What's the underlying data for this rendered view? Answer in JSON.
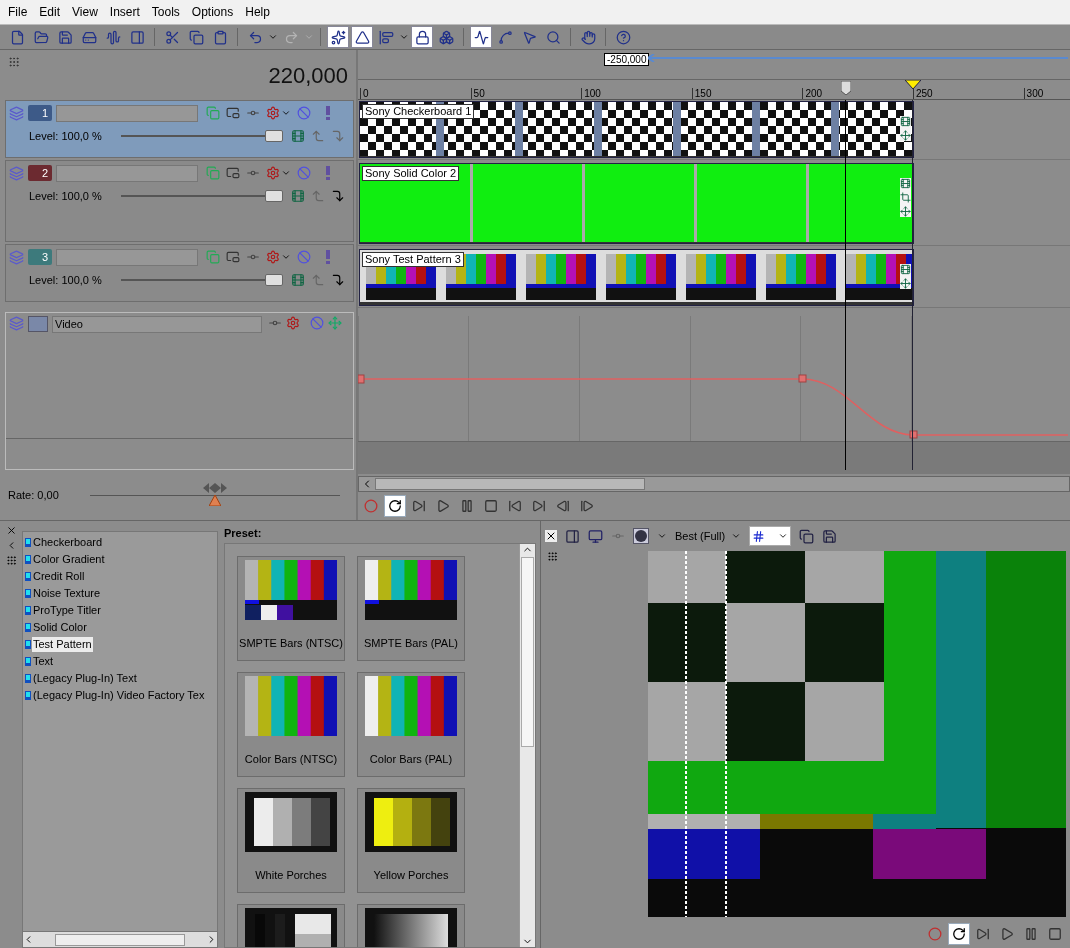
{
  "menu": [
    "File",
    "Edit",
    "View",
    "Insert",
    "Tools",
    "Options",
    "Help"
  ],
  "toolbar": [
    {
      "kind": "new",
      "on": false,
      "disabled": false
    },
    {
      "kind": "open",
      "on": false,
      "disabled": false
    },
    {
      "kind": "save",
      "on": false,
      "disabled": false
    },
    {
      "kind": "save-as",
      "on": false,
      "disabled": false
    },
    {
      "kind": "render",
      "on": false,
      "disabled": false
    },
    {
      "kind": "properties",
      "on": false,
      "disabled": false
    },
    {
      "kind": "sep"
    },
    {
      "kind": "cut",
      "on": false,
      "disabled": false
    },
    {
      "kind": "copy",
      "on": false,
      "disabled": false
    },
    {
      "kind": "paste",
      "on": false,
      "disabled": false
    },
    {
      "kind": "sep"
    },
    {
      "kind": "undo",
      "on": false,
      "disabled": false
    },
    {
      "kind": "dropdown",
      "on": false,
      "disabled": false
    },
    {
      "kind": "redo",
      "on": false,
      "disabled": true
    },
    {
      "kind": "dropdown",
      "on": false,
      "disabled": true
    },
    {
      "kind": "sep"
    },
    {
      "kind": "auto-crossfade",
      "on": true,
      "disabled": false
    },
    {
      "kind": "snap",
      "on": true,
      "disabled": false
    },
    {
      "kind": "align",
      "on": false,
      "disabled": false
    },
    {
      "kind": "dropdown",
      "on": false,
      "disabled": false
    },
    {
      "kind": "lock-envelopes",
      "on": true,
      "disabled": false
    },
    {
      "kind": "ignore-grouping",
      "on": false,
      "disabled": false
    },
    {
      "kind": "sep"
    },
    {
      "kind": "edit-tool",
      "on": true,
      "disabled": false
    },
    {
      "kind": "envelope-tool",
      "on": false,
      "disabled": false
    },
    {
      "kind": "selection-tool",
      "on": false,
      "disabled": false
    },
    {
      "kind": "zoom-tool",
      "on": false,
      "disabled": false
    },
    {
      "kind": "sep"
    },
    {
      "kind": "touch",
      "on": false,
      "disabled": false
    },
    {
      "kind": "sep"
    },
    {
      "kind": "help",
      "on": false,
      "disabled": false
    }
  ],
  "time": "220,000",
  "marker_label": "-250,000",
  "ruler": [
    "0",
    "50",
    "100",
    "150",
    "200",
    "250",
    "300"
  ],
  "tracks": [
    {
      "number": "1",
      "color": "#3d5a88",
      "selected": true,
      "level_text": "Level: 100,0 %",
      "level": 1,
      "clip": {
        "name": "Sony Checkerboard 1",
        "kind": "checkerboard"
      }
    },
    {
      "number": "2",
      "color": "#6c2a30",
      "selected": false,
      "level_text": "Level: 100,0 %",
      "level": 1,
      "clip": {
        "name": "Sony Solid Color 2",
        "kind": "solid"
      }
    },
    {
      "number": "3",
      "color": "#3d7a7c",
      "selected": false,
      "level_text": "Level: 100,0 %",
      "level": 1,
      "clip": {
        "name": "Sony Test Pattern 3",
        "kind": "bars"
      }
    }
  ],
  "bus": {
    "name": "Video"
  },
  "rate": {
    "text": "Rate: 0,00",
    "level": 0.5
  },
  "transport": [
    {
      "kind": "record",
      "on": false
    },
    {
      "kind": "loop",
      "on": true
    },
    {
      "kind": "play-start",
      "on": false
    },
    {
      "kind": "play",
      "on": false
    },
    {
      "kind": "pause",
      "on": false
    },
    {
      "kind": "stop",
      "on": false
    },
    {
      "kind": "go-start",
      "on": false
    },
    {
      "kind": "go-end",
      "on": false
    },
    {
      "kind": "prev-frame",
      "on": false
    },
    {
      "kind": "next-frame",
      "on": false
    }
  ],
  "generators": [
    {
      "name": "Checkerboard",
      "selected": false
    },
    {
      "name": "Color Gradient",
      "selected": false
    },
    {
      "name": "Credit Roll",
      "selected": false
    },
    {
      "name": "Noise Texture",
      "selected": false
    },
    {
      "name": "ProType Titler",
      "selected": false
    },
    {
      "name": "Solid Color",
      "selected": false
    },
    {
      "name": "Test Pattern",
      "selected": true
    },
    {
      "name": "Text",
      "selected": false
    },
    {
      "name": "(Legacy Plug-In) Text",
      "selected": false
    },
    {
      "name": "(Legacy Plug-In) Video Factory Tex",
      "selected": false
    }
  ],
  "preset_label": "Preset:",
  "presets": [
    {
      "name": "SMPTE Bars (NTSC)",
      "kind": "smpte-ntsc"
    },
    {
      "name": "SMPTE Bars (PAL)",
      "kind": "smpte-pal"
    },
    {
      "name": "Color Bars (NTSC)",
      "kind": "bars-ntsc"
    },
    {
      "name": "Color Bars (PAL)",
      "kind": "bars-pal"
    },
    {
      "name": "White Porches",
      "kind": "white-porches"
    },
    {
      "name": "Yellow Porches",
      "kind": "yellow-porches"
    },
    {
      "kind": "gray-steps"
    },
    {
      "kind": "gradient"
    }
  ],
  "preview": {
    "quality": "Best (Full)",
    "overlay_on": true,
    "transport": [
      {
        "kind": "record",
        "on": false
      },
      {
        "kind": "loop",
        "on": true
      },
      {
        "kind": "play-start",
        "on": false
      },
      {
        "kind": "play",
        "on": false
      },
      {
        "kind": "pause",
        "on": false
      },
      {
        "kind": "stop",
        "on": false
      }
    ]
  }
}
